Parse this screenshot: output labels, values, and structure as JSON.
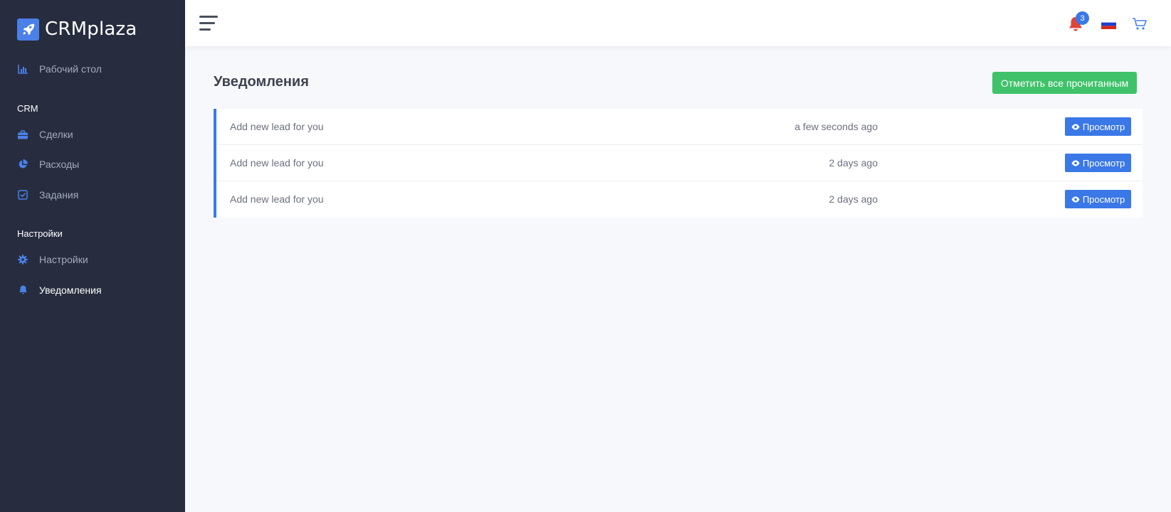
{
  "brand": {
    "name": "CRMplaza"
  },
  "sidebar": {
    "dashboard": {
      "label": "Рабочий стол"
    },
    "section_crm": "CRM",
    "crm_items": [
      {
        "label": "Сделки"
      },
      {
        "label": "Расходы"
      },
      {
        "label": "Задания"
      }
    ],
    "section_settings": "Настройки",
    "settings_items": [
      {
        "label": "Настройки"
      },
      {
        "label": "Уведомления"
      }
    ]
  },
  "header": {
    "notification_count": "3"
  },
  "main": {
    "title": "Уведомления",
    "mark_all_label": "Отметить все прочитанным",
    "view_label": "Просмотр",
    "notifications": [
      {
        "message": "Add new lead for you",
        "time": "a few seconds ago"
      },
      {
        "message": "Add new lead for you",
        "time": "2 days ago"
      },
      {
        "message": "Add new lead for you",
        "time": "2 days ago"
      }
    ]
  },
  "colors": {
    "sidebar_bg": "#272d3f",
    "accent_blue": "#3b78e7",
    "success_green": "#40c26a",
    "bell_red": "#e0453b"
  },
  "icons": {
    "dashboard": "chart-icon",
    "deals": "briefcase-icon",
    "expenses": "pie-chart-icon",
    "tasks": "checkbox-icon",
    "settings": "gear-icon",
    "notifications": "bell-icon"
  }
}
